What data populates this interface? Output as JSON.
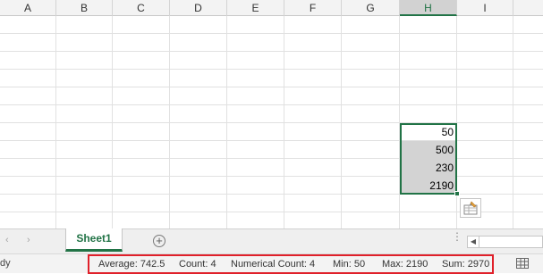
{
  "columns": [
    "A",
    "B",
    "C",
    "D",
    "E",
    "F",
    "G",
    "H",
    "I"
  ],
  "selected_column": "H",
  "cells": [
    {
      "ref": "H7",
      "value": "50",
      "shaded": false
    },
    {
      "ref": "H8",
      "value": "500",
      "shaded": true
    },
    {
      "ref": "H9",
      "value": "230",
      "shaded": true
    },
    {
      "ref": "H10",
      "value": "2190",
      "shaded": true
    }
  ],
  "sheet_tabs": {
    "active": "Sheet1",
    "add_sheet_symbol": "+",
    "prev_arrow": "‹",
    "next_arrow": "›",
    "more_symbol": "⋮",
    "scroll_left_arrow": "◀"
  },
  "status_bar": {
    "ready_fragment": "dy",
    "average": "Average: 742.5",
    "count": "Count: 4",
    "numerical_count": "Numerical Count: 4",
    "min": "Min: 50",
    "max": "Max: 2190",
    "sum": "Sum: 2970"
  },
  "icons": {
    "quick_analysis": "quick-analysis-icon",
    "add_sheet": "plus-circle-icon",
    "normal_view": "grid-view-icon"
  },
  "colors": {
    "accent": "#217346",
    "highlight_box": "#e0202a",
    "shaded_cell": "#d3d3d3"
  }
}
